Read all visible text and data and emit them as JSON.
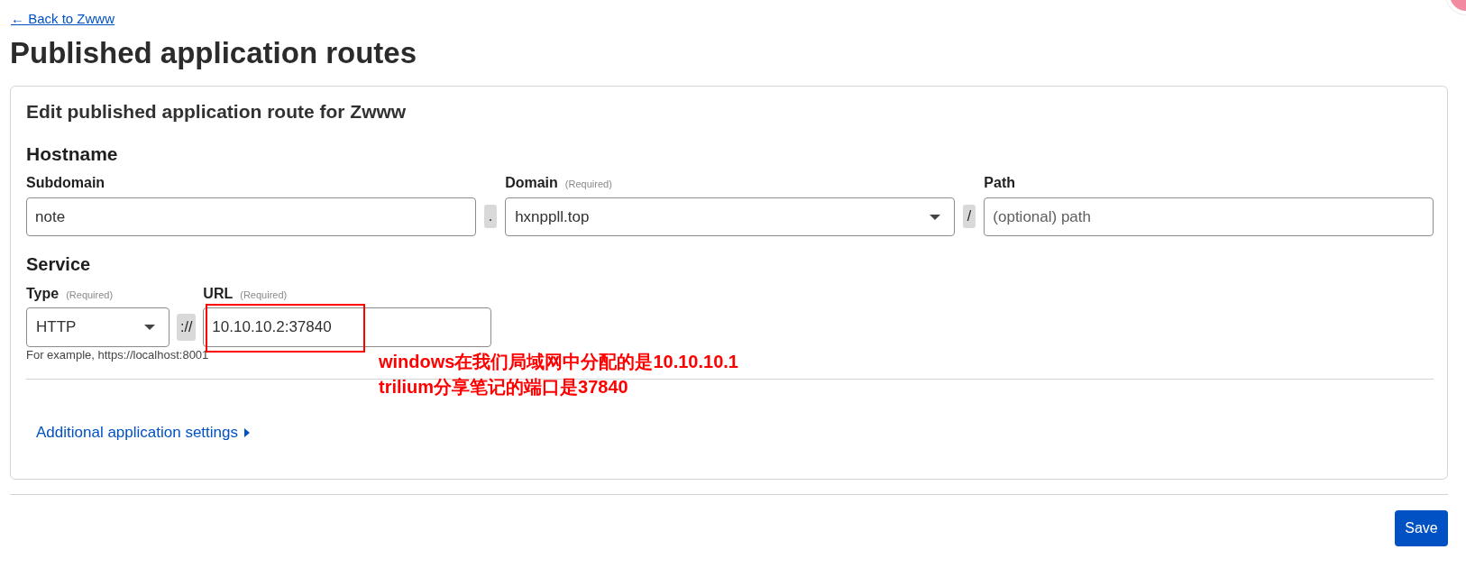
{
  "back_link": {
    "label": "← Back to Zwww"
  },
  "page_title": "Published application routes",
  "card": {
    "heading": "Edit published application route for Zwww",
    "sections": [
      {
        "kind": "hostname",
        "heading": "Hostname",
        "items": [
          {
            "kind": "input",
            "label": "Subdomain",
            "value": "note",
            "highlighted": false
          },
          {
            "kind": "separator",
            "text": "."
          },
          {
            "kind": "select",
            "label": "Domain",
            "hint": "(Required)",
            "value": "hxnppll.top",
            "highlighted": false
          },
          {
            "kind": "separator",
            "text": "/"
          },
          {
            "kind": "input",
            "label": "Path",
            "placeholder": "(optional) path",
            "highlighted": false
          }
        ]
      },
      {
        "kind": "service",
        "heading": "Service",
        "items": [
          {
            "kind": "select",
            "label": "Type",
            "hint": "(Required)",
            "value": "HTTP",
            "highlighted": false
          },
          {
            "kind": "separator",
            "text": "://"
          },
          {
            "kind": "input",
            "label": "URL",
            "hint": "(Required)",
            "value": "10.10.10.2:37840",
            "highlighted": true
          }
        ],
        "helper": "For example, https://localhost:8001",
        "annotation": [
          "windows在我们局域网中分配的是10.10.10.1",
          "trilium分享笔记的端口是37840"
        ]
      }
    ],
    "additional_settings": {
      "label": "Additional application settings",
      "expanded": false
    }
  },
  "save_button": {
    "label": "Save"
  }
}
